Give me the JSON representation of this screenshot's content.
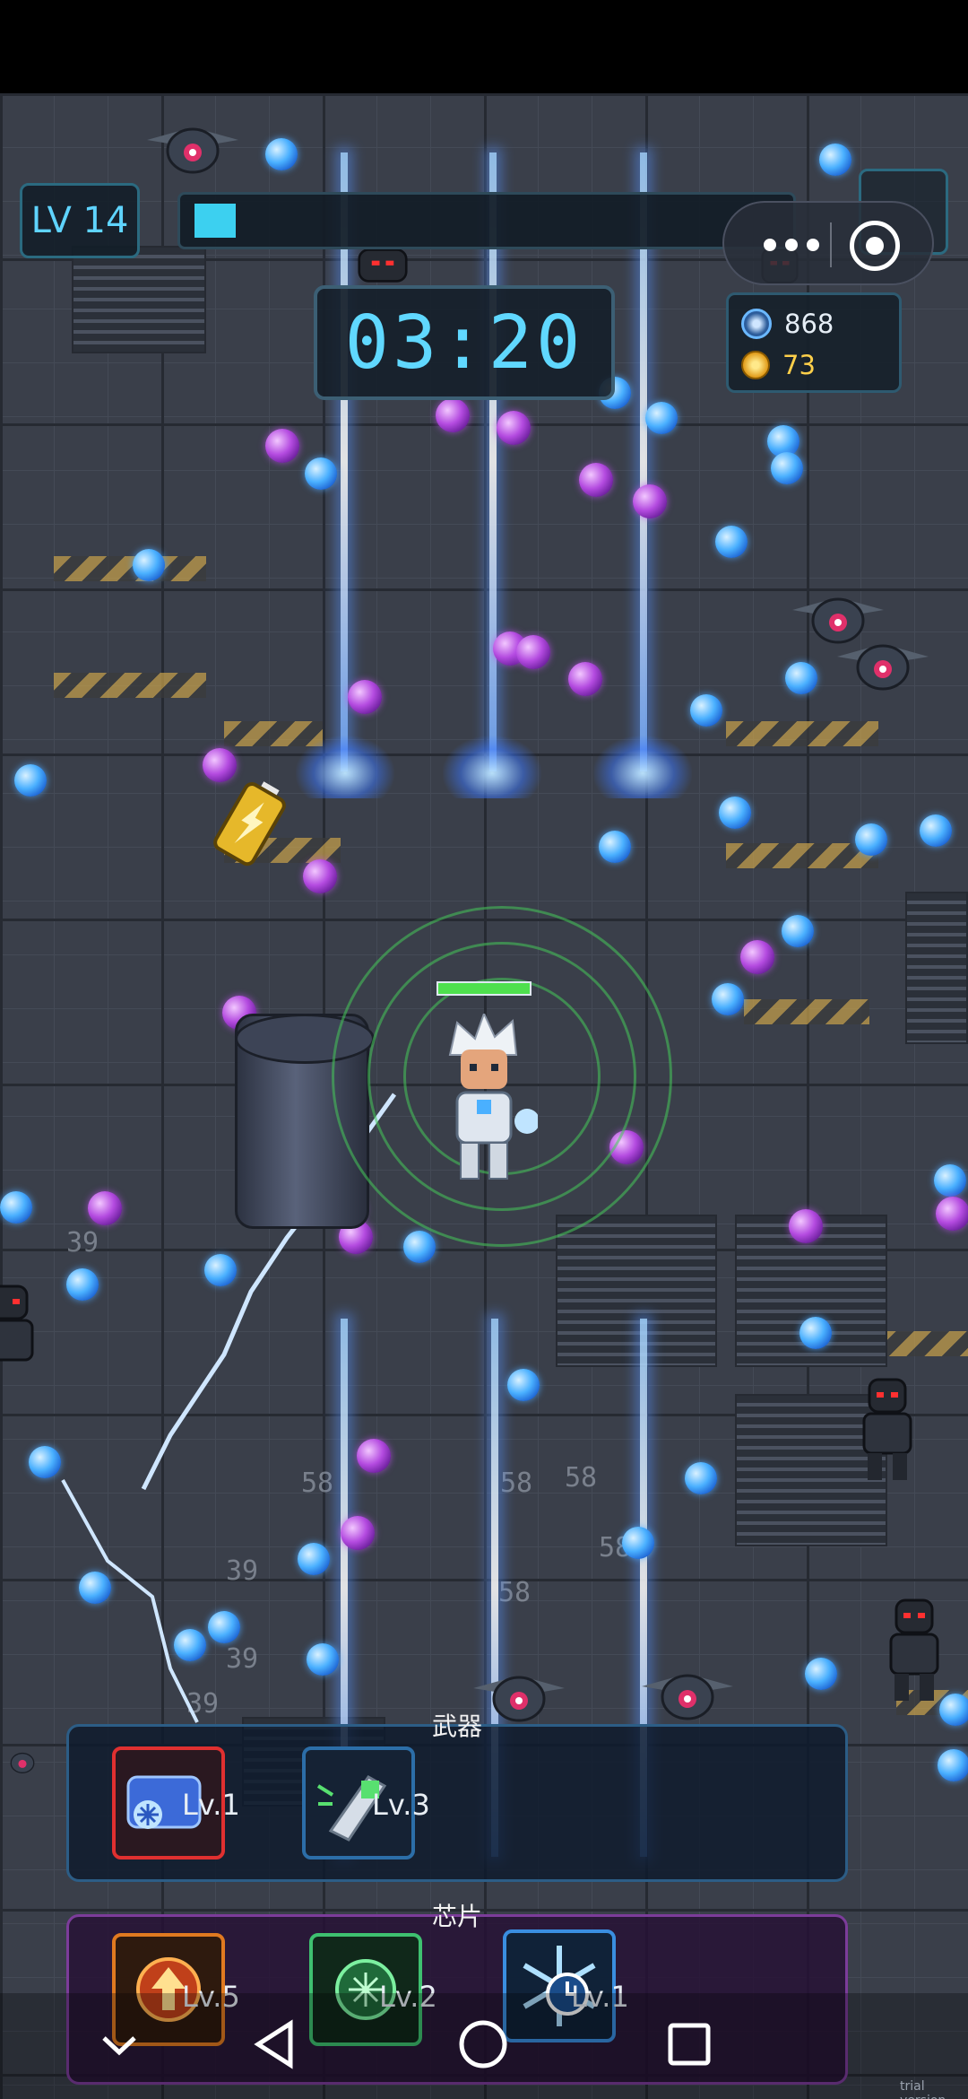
{
  "hud": {
    "level_label": "LV 14",
    "xp_progress": 0.07,
    "timer": "03:20",
    "kills": "868",
    "coins": "73",
    "pause_icon": "pause-icon",
    "more_icon": "more-dots-icon",
    "close_icon": "close-mini-program-icon"
  },
  "battlefield": {
    "damage_numbers": [
      "39",
      "58",
      "58",
      "58",
      "58",
      "58",
      "39",
      "39",
      "39"
    ],
    "player_hp": 1.0
  },
  "weapons": {
    "title": "武器",
    "slots": [
      {
        "icon": "frost-cannon-icon",
        "level": "Lv.1",
        "border": "#e03030"
      },
      {
        "icon": "energy-gauntlet-icon",
        "level": "Lv.3",
        "border": "#2c6ea8"
      }
    ]
  },
  "chips": {
    "title": "芯片",
    "slots": [
      {
        "icon": "power-up-arrow-icon",
        "level": "Lv.5",
        "border": "#e07a20"
      },
      {
        "icon": "brain-circuit-icon",
        "level": "Lv.2",
        "border": "#3ec070"
      },
      {
        "icon": "snowflake-clock-icon",
        "level": "Lv.1",
        "border": "#3a8ee0"
      }
    ]
  },
  "nav": {
    "hide_icon": "chevron-down-icon",
    "back_icon": "back-triangle-icon",
    "home_icon": "home-circle-icon",
    "recents_icon": "recents-square-icon"
  },
  "watermark": "trial version",
  "colors": {
    "accent_cyan": "#5fd4ff",
    "coin_gold": "#ffd04a",
    "weapon_frame": "#2c5d86",
    "chip_frame": "#7c3c9a"
  }
}
